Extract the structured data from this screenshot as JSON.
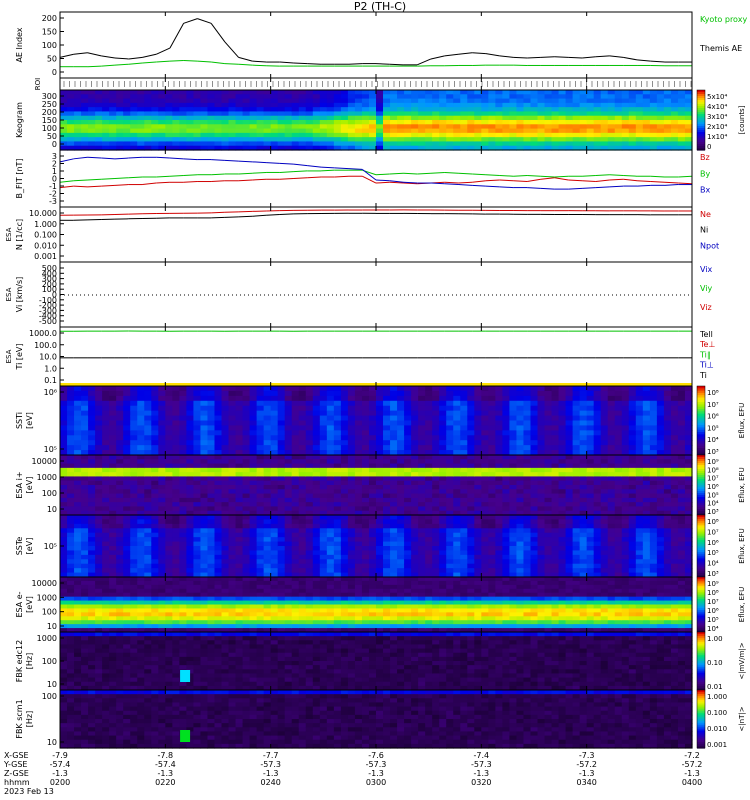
{
  "chart_data": {
    "type": "line",
    "title": "P2 (TH-C)",
    "time_ticks": [
      "0200",
      "0220",
      "0240",
      "0300",
      "0320",
      "0340",
      "0400"
    ],
    "footer": {
      "row_labels": [
        "X-GSE",
        "Y-GSE",
        "Z-GSE",
        "hhmm",
        "2023 Feb 13"
      ],
      "x_gse": [
        "-7.9",
        "-7.8",
        "-7.7",
        "-7.6",
        "-7.4",
        "-7.3",
        "-7.2"
      ],
      "y_gse": [
        "-57.4",
        "-57.4",
        "-57.3",
        "-57.3",
        "-57.3",
        "-57.2",
        "-57.2"
      ],
      "z_gse": [
        "-1.3",
        "-1.3",
        "-1.3",
        "-1.3",
        "-1.3",
        "-1.3",
        "-1.3"
      ]
    },
    "panels": [
      {
        "id": "ae",
        "type": "line",
        "ylabel": "AE Index",
        "yticks": [
          "200",
          "150",
          "100",
          "50",
          "0"
        ],
        "ylim": [
          0,
          200
        ],
        "series": [
          {
            "name": "Kyoto proxy AE",
            "color": "#00c000",
            "values": [
              30,
              30,
              30,
              32,
              35,
              38,
              42,
              45,
              48,
              50,
              48,
              45,
              40,
              38,
              35,
              33,
              32,
              32,
              32,
              32,
              32,
              32,
              32,
              32,
              32,
              32,
              32,
              33,
              33,
              34,
              34,
              35,
              35,
              35,
              34,
              34,
              34,
              34,
              34,
              34,
              34,
              34,
              34,
              34,
              33,
              33,
              33
            ]
          },
          {
            "name": "Themis AE",
            "color": "#000000",
            "values": [
              60,
              70,
              75,
              65,
              58,
              55,
              60,
              70,
              90,
              170,
              185,
              170,
              110,
              60,
              48,
              45,
              45,
              42,
              40,
              38,
              38,
              38,
              40,
              40,
              38,
              36,
              36,
              55,
              65,
              70,
              75,
              72,
              65,
              60,
              58,
              60,
              62,
              60,
              58,
              62,
              65,
              60,
              52,
              48,
              45,
              45,
              45
            ]
          }
        ]
      },
      {
        "id": "roi",
        "type": "tickstrip",
        "ylabel": "ROI"
      },
      {
        "id": "keogram",
        "type": "heatmap",
        "ylabel": "Keogram",
        "yticks": [
          "300",
          "250",
          "200",
          "150",
          "100",
          "50",
          "0"
        ],
        "cbar_ticks": [
          "5x10⁴",
          "4x10⁴",
          "3x10⁴",
          "2x10⁴",
          "1x10⁴",
          "0"
        ],
        "cbar_label": "[counts]"
      },
      {
        "id": "bfield",
        "type": "line",
        "ylabel": "B_FIT [nT]",
        "yticks": [
          "3",
          "2",
          "1",
          "0",
          "-1",
          "-2",
          "-3"
        ],
        "ylim": [
          -3.5,
          3.5
        ],
        "series": [
          {
            "name": "Bz",
            "color": "#d00000",
            "values": [
              -1.2,
              -1.0,
              -1.1,
              -1.0,
              -0.9,
              -0.8,
              -0.8,
              -0.6,
              -0.5,
              -0.5,
              -0.4,
              -0.4,
              -0.3,
              -0.3,
              -0.2,
              -0.1,
              -0.1,
              0.0,
              0.1,
              0.2,
              0.2,
              0.3,
              0.3,
              -0.6,
              -0.5,
              -0.6,
              -0.7,
              -0.6,
              -0.5,
              -0.6,
              -0.5,
              -0.3,
              -0.2,
              -0.3,
              -0.4,
              -0.1,
              0.1,
              -0.2,
              -0.3,
              -0.4,
              -0.2,
              -0.1,
              -0.3,
              -0.4,
              -0.5,
              -0.6,
              -0.7
            ]
          },
          {
            "name": "By",
            "color": "#00c000",
            "values": [
              -0.5,
              -0.3,
              -0.2,
              -0.1,
              0.0,
              0.1,
              0.2,
              0.2,
              0.3,
              0.4,
              0.5,
              0.5,
              0.6,
              0.6,
              0.7,
              0.8,
              0.8,
              0.9,
              1.0,
              1.0,
              1.1,
              1.1,
              1.1,
              0.5,
              0.6,
              0.7,
              0.6,
              0.7,
              0.8,
              0.7,
              0.6,
              0.5,
              0.4,
              0.3,
              0.4,
              0.3,
              0.2,
              0.3,
              0.3,
              0.4,
              0.5,
              0.4,
              0.3,
              0.3,
              0.2,
              0.2,
              0.3
            ]
          },
          {
            "name": "Bx",
            "color": "#0000c0",
            "values": [
              2.2,
              2.6,
              2.8,
              2.7,
              2.6,
              2.7,
              2.8,
              2.8,
              2.7,
              2.6,
              2.5,
              2.5,
              2.4,
              2.3,
              2.2,
              2.1,
              2.0,
              1.9,
              1.7,
              1.5,
              1.4,
              1.3,
              1.2,
              -0.2,
              -0.3,
              -0.5,
              -0.6,
              -0.6,
              -0.7,
              -0.8,
              -0.9,
              -1.0,
              -1.1,
              -1.2,
              -1.2,
              -1.3,
              -1.4,
              -1.4,
              -1.3,
              -1.2,
              -1.1,
              -1.0,
              -1.0,
              -0.9,
              -0.9,
              -0.8,
              -0.8
            ]
          }
        ]
      },
      {
        "id": "density",
        "type": "line",
        "ylabel": "N [1/cc]",
        "ylabel_sub": "ESA",
        "yticks": [
          "10.000",
          "1.000",
          "0.100",
          "0.010",
          "0.001"
        ],
        "ylim": [
          0.001,
          10
        ],
        "log": true,
        "series": [
          {
            "name": "Ne",
            "color": "#d00000",
            "values": [
              3.2,
              3.3,
              3.4,
              3.5,
              3.7,
              4.0,
              4.2,
              4.4,
              4.5,
              4.6,
              4.8,
              5.0,
              5.5,
              6.0,
              6.5,
              7.0,
              7.5,
              7.8,
              8.0,
              8.2,
              8.2,
              8.3,
              8.3,
              8.4,
              8.4,
              8.5,
              8.4,
              8.3,
              8.2,
              8.0,
              7.9,
              7.8,
              7.7,
              7.6,
              7.5,
              7.4,
              7.4,
              7.4,
              7.3,
              7.3,
              7.2,
              7.2,
              7.2,
              7.1,
              7.0,
              7.0,
              7.0
            ]
          },
          {
            "name": "Ni",
            "color": "#000000",
            "values": [
              1.3,
              1.3,
              1.4,
              1.5,
              1.6,
              1.7,
              1.8,
              1.9,
              2.0,
              2.0,
              2.0,
              2.0,
              2.2,
              2.4,
              2.7,
              3.2,
              3.7,
              4.1,
              4.3,
              4.4,
              4.5,
              4.6,
              4.6,
              4.5,
              4.5,
              4.5,
              4.4,
              4.3,
              4.3,
              4.2,
              4.1,
              4.0,
              4.0,
              3.9,
              3.8,
              3.8,
              3.7,
              3.7,
              3.7,
              3.6,
              3.6,
              3.6,
              3.6,
              3.5,
              3.5,
              3.5,
              3.5
            ]
          },
          {
            "name": "Npot",
            "color": "#0000c0",
            "values": []
          }
        ]
      },
      {
        "id": "velocity",
        "type": "line",
        "ylabel": "Vi [km/s]",
        "ylabel_sub": "ESA",
        "yticks": [
          "500",
          "400",
          "300",
          "200",
          "100",
          "0",
          "-100",
          "-200",
          "-300",
          "-400",
          "-500"
        ],
        "ylim": [
          -500,
          500
        ],
        "series": [
          {
            "name": "Vix",
            "color": "#0000c0",
            "values": []
          },
          {
            "name": "Viy",
            "color": "#00c000",
            "values": []
          },
          {
            "name": "Viz",
            "color": "#d00000",
            "values": []
          }
        ]
      },
      {
        "id": "temperature",
        "type": "line",
        "ylabel": "Ti [eV]",
        "ylabel_sub": "ESA",
        "yticks": [
          "1000.0",
          "100.0",
          "10.0",
          "1.0",
          "0.1"
        ],
        "ylim": [
          0.1,
          1000
        ],
        "log": true,
        "series": [
          {
            "name": "Tell",
            "color": "#000000",
            "values": []
          },
          {
            "name": "Te⊥",
            "color": "#d00000",
            "values": []
          },
          {
            "name": "Ti∥",
            "color": "#00c000",
            "values": [
              680,
              690,
              700,
              700,
              700,
              710,
              700,
              700,
              690,
              700,
              700,
              700,
              690,
              700,
              700,
              700,
              700,
              690,
              700,
              700,
              700,
              700,
              700,
              700,
              700,
              700,
              700,
              700,
              700,
              700,
              700,
              700,
              700,
              700,
              700,
              700,
              700,
              700,
              700,
              700,
              700,
              700,
              700,
              700,
              700,
              700,
              700
            ]
          },
          {
            "name": "Ti⊥",
            "color": "#0000c0",
            "values": []
          },
          {
            "name": "Ti",
            "color": "#000000",
            "values": [
              8,
              8,
              8,
              8,
              8,
              8,
              8,
              8,
              8,
              8,
              8,
              8,
              8,
              8,
              8,
              8,
              8,
              8,
              8,
              8,
              8,
              8,
              8,
              8,
              8,
              8,
              8,
              8,
              8,
              8,
              8,
              8,
              8,
              8,
              8,
              8,
              8,
              8,
              8,
              8,
              8,
              8,
              8,
              8,
              8,
              8,
              8
            ]
          }
        ]
      },
      {
        "id": "ssti",
        "type": "heatmap",
        "ylabel": "SSTi",
        "ylabel2": "[eV]",
        "yticks": [
          "10⁶",
          "10⁵"
        ],
        "cbar_ticks": [
          "10⁸",
          "10⁷",
          "10⁶",
          "10⁵",
          "10⁴",
          "10³"
        ],
        "cbar_label": "Eflux, EFU"
      },
      {
        "id": "esai",
        "type": "heatmap",
        "ylabel": "ESA i+",
        "ylabel2": "[eV]",
        "yticks": [
          "10000",
          "1000",
          "100",
          "10"
        ],
        "cbar_ticks": [
          "10⁹",
          "10⁸",
          "10⁷",
          "10⁶",
          "10⁵",
          "10⁴",
          "10³"
        ],
        "cbar_label": "Eflux, EFU"
      },
      {
        "id": "sste",
        "type": "heatmap",
        "ylabel": "SSTe",
        "ylabel2": "[eV]",
        "yticks": [
          "10⁵"
        ],
        "cbar_ticks": [
          "10⁸",
          "10⁷",
          "10⁶",
          "10⁵",
          "10⁴",
          "10³"
        ],
        "cbar_label": "Eflux, EFU"
      },
      {
        "id": "esae",
        "type": "heatmap",
        "ylabel": "ESA e-",
        "ylabel2": "[eV]",
        "yticks": [
          "10000",
          "1000",
          "100",
          "10"
        ],
        "cbar_ticks": [
          "10⁹",
          "10⁸",
          "10⁷",
          "10⁶",
          "10⁵",
          "10⁴"
        ],
        "cbar_label": "Eflux, EFU"
      },
      {
        "id": "fbke",
        "type": "heatmap",
        "ylabel": "FBK edc12",
        "ylabel2": "[Hz]",
        "yticks": [
          "1000",
          "100",
          "10"
        ],
        "cbar_ticks": [
          "1.00",
          "0.10",
          "0.01"
        ],
        "cbar_label": "<|mV/m|>"
      },
      {
        "id": "fbkb",
        "type": "heatmap",
        "ylabel": "FBK scm1",
        "ylabel2": "[Hz]",
        "yticks": [
          "100",
          "10"
        ],
        "cbar_ticks": [
          "1.000",
          "0.100",
          "0.010",
          "0.001"
        ],
        "cbar_label": "<|nT|>"
      }
    ]
  }
}
